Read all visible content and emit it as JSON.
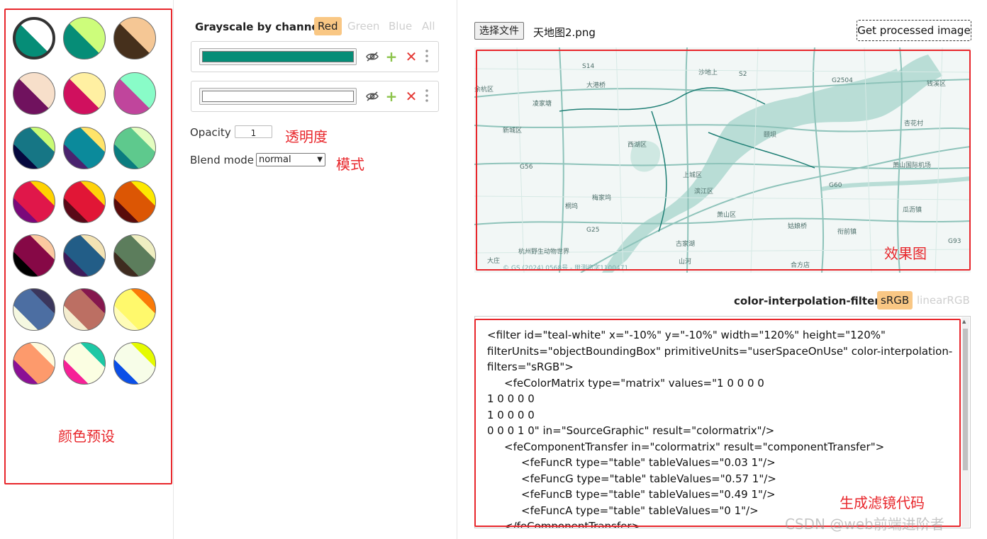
{
  "presets": [
    {
      "name": "teal-white",
      "type": "diag",
      "c1": "#068d77",
      "c2": "#ffffff",
      "selected": true
    },
    {
      "name": "teal-lime",
      "type": "diag",
      "c1": "#068d77",
      "c2": "#cdfd7b"
    },
    {
      "name": "brown-peach",
      "type": "diag",
      "c1": "#46301c",
      "c2": "#f5c795"
    },
    {
      "name": "purple-cream",
      "type": "diag",
      "c1": "#70125e",
      "c2": "#f7dfca"
    },
    {
      "name": "crimson-yellow",
      "type": "diag",
      "c1": "#d0105e",
      "c2": "#fff0a2"
    },
    {
      "name": "magenta-mint",
      "type": "diag",
      "c1": "#c0459c",
      "c2": "#89fcc8"
    },
    {
      "name": "navy-teal-lime",
      "type": "tri",
      "c1": "#06083e",
      "c2": "#167685",
      "c3": "#c9fb76"
    },
    {
      "name": "purple-teal-yellow",
      "type": "tri",
      "c1": "#4a236e",
      "c2": "#0b8a9b",
      "c3": "#ffe46a"
    },
    {
      "name": "teal-green-pale",
      "type": "tri",
      "c1": "#0b7c7f",
      "c2": "#5ec98d",
      "c3": "#e4fdc0"
    },
    {
      "name": "purple-crimson-yellow",
      "type": "tri",
      "c1": "#7a087a",
      "c2": "#e0174a",
      "c3": "#ffd200"
    },
    {
      "name": "maroon-red-yellow",
      "type": "tri",
      "c1": "#5a0918",
      "c2": "#e11636",
      "c3": "#ffd20a"
    },
    {
      "name": "maroon-orange-yellow",
      "type": "tri",
      "c1": "#590b0b",
      "c2": "#dc5604",
      "c3": "#fde900"
    },
    {
      "name": "black-wine-peach",
      "type": "tri",
      "c1": "#000000",
      "c2": "#860846",
      "c3": "#fbc8a0"
    },
    {
      "name": "indigo-blue-cream",
      "type": "tri",
      "c1": "#3d1b5a",
      "c2": "#225d87",
      "c3": "#f3e3b4"
    },
    {
      "name": "brown-green-cream",
      "type": "tri",
      "c1": "#3e2b1f",
      "c2": "#5c7d5c",
      "c3": "#efeec1"
    },
    {
      "name": "cream-blue-slate",
      "type": "tri",
      "c1": "#f5f8e1",
      "c2": "#4c6ea2",
      "c3": "#3b365c"
    },
    {
      "name": "cream-rose-plum",
      "type": "tri",
      "c1": "#f4edcf",
      "c2": "#bc6f63",
      "c3": "#85174e"
    },
    {
      "name": "yellow-orange",
      "type": "tri",
      "c1": "#fffcb8",
      "c2": "#fff96c",
      "c3": "#fa7a08"
    },
    {
      "name": "purple-orange-cream",
      "type": "tri",
      "c1": "#8b1095",
      "c2": "#fd9a6c",
      "c3": "#fefbdc"
    },
    {
      "name": "pink-cream-teal",
      "type": "tri",
      "c1": "#f62197",
      "c2": "#fbfee2",
      "c3": "#1dc8a5"
    },
    {
      "name": "blue-white-lime",
      "type": "tri",
      "c1": "#0b4fe7",
      "c2": "#f7fde8",
      "c3": "#e5fb00"
    }
  ],
  "annotations": {
    "presets": "颜色预设",
    "opacity": "透明度",
    "mode": "模式",
    "effect": "效果图",
    "code": "生成滤镜代码"
  },
  "grayscale": {
    "label": "Grayscale by channel:",
    "buttons": [
      "Red",
      "Green",
      "Blue",
      "All"
    ],
    "active": "Red"
  },
  "layers": [
    {
      "color": "#068d77"
    },
    {
      "color": "#ffffff"
    }
  ],
  "opacity": {
    "label": "Opacity",
    "value": "1"
  },
  "blend": {
    "label": "Blend mode",
    "value": "normal"
  },
  "file": {
    "button": "选择文件",
    "name": "天地图2.png"
  },
  "get_button": "Get processed image",
  "map": {
    "labels": [
      "S14",
      "大港桥",
      "沙地上",
      "S2",
      "G2504",
      "钱溪区",
      "凌家塘",
      "新城区",
      "杏花村",
      "余杭区",
      "颐坝",
      "西湖区",
      "G56",
      "上城区",
      "萧山国际机场",
      "梅家坞",
      "滨江区",
      "G60",
      "桐坞",
      "G25",
      "萧山区",
      "姑娘桥",
      "瓜沥镇",
      "杭州野生动物世界",
      "古家湖",
      "衔前镇",
      "大庄",
      "山河",
      "合方店",
      "G93"
    ],
    "copyright": "© GS (2024) 0568号 - 甲测资字1100471"
  },
  "cif": {
    "label": "color-interpolation-filters:",
    "buttons": [
      "sRGB",
      "linearRGB"
    ],
    "active": "sRGB"
  },
  "code_lines": [
    {
      "indent": 0,
      "text": "<filter id=\"teal-white\" x=\"-10%\" y=\"-10%\" width=\"120%\" height=\"120%\""
    },
    {
      "indent": 0,
      "text": "filterUnits=\"objectBoundingBox\" primitiveUnits=\"userSpaceOnUse\" color-interpolation-"
    },
    {
      "indent": 0,
      "text": "filters=\"sRGB\">"
    },
    {
      "indent": 1,
      "text": "<feColorMatrix type=\"matrix\" values=\"1 0 0 0 0"
    },
    {
      "indent": 0,
      "text": "1 0 0 0 0"
    },
    {
      "indent": 0,
      "text": "1 0 0 0 0"
    },
    {
      "indent": 0,
      "text": "0 0 0 1 0\" in=\"SourceGraphic\" result=\"colormatrix\"/>"
    },
    {
      "indent": 1,
      "text": "<feComponentTransfer in=\"colormatrix\" result=\"componentTransfer\">"
    },
    {
      "indent": 2,
      "text": "<feFuncR type=\"table\" tableValues=\"0.03 1\"/>"
    },
    {
      "indent": 2,
      "text": "<feFuncG type=\"table\" tableValues=\"0.57 1\"/>"
    },
    {
      "indent": 2,
      "text": "<feFuncB type=\"table\" tableValues=\"0.49 1\"/>"
    },
    {
      "indent": 2,
      "text": "<feFuncA type=\"table\" tableValues=\"0 1\"/>"
    },
    {
      "indent": 1,
      "text": "</feComponentTransfer>"
    }
  ],
  "watermark": "CSDN @web前端进阶者",
  "colors": {
    "accent": "#f9c784",
    "annotation": "#e8262b",
    "plus": "#8bc34a",
    "delete": "#e53935"
  }
}
